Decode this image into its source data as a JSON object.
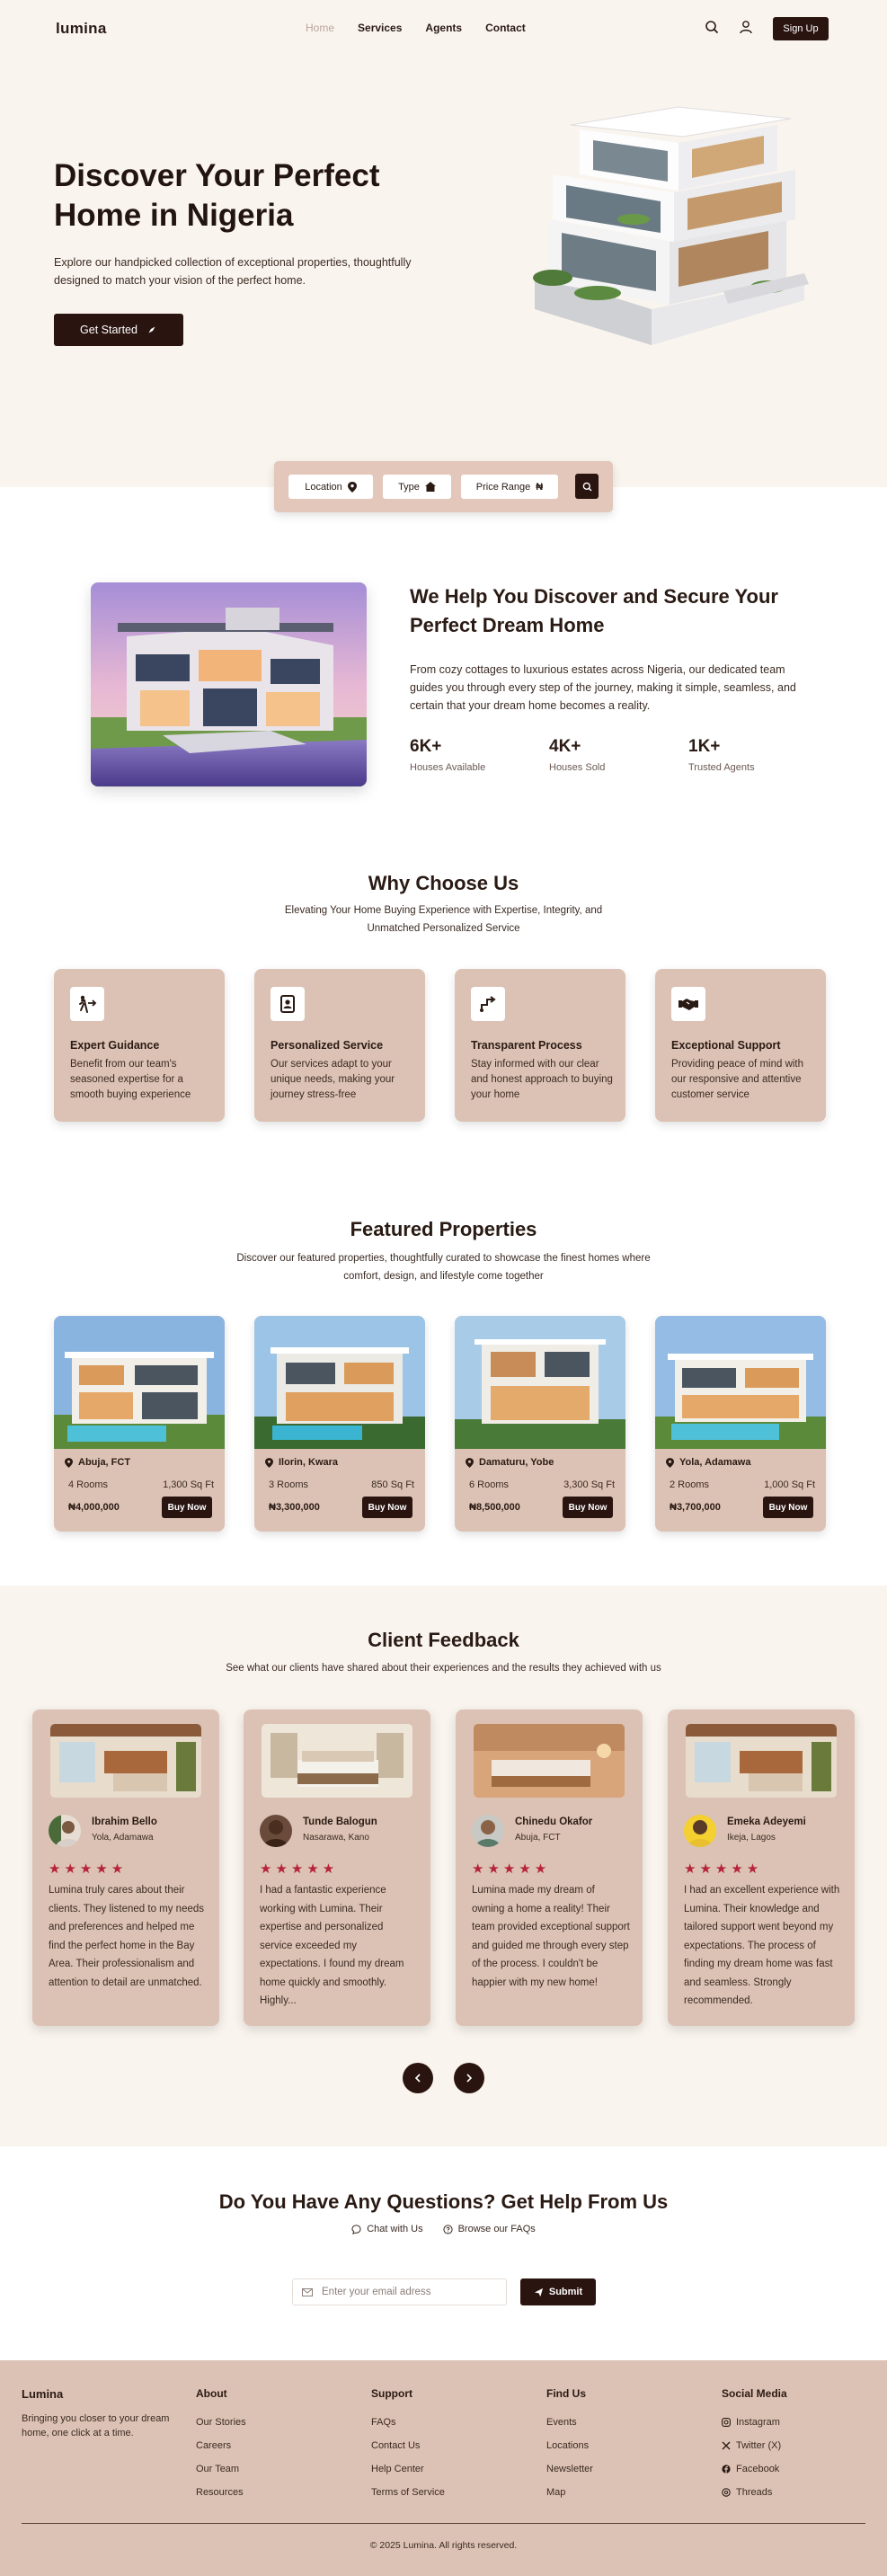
{
  "nav": {
    "logo": "lumina",
    "links": [
      "Home",
      "Services",
      "Agents",
      "Contact"
    ],
    "signup": "Sign Up"
  },
  "hero": {
    "title": "Discover Your Perfect Home in Nigeria",
    "subtitle": "Explore our handpicked collection of exceptional properties, thoughtfully designed to match your vision of the perfect home.",
    "cta": "Get Started"
  },
  "search": {
    "location": "Location",
    "type": "Type",
    "price": "Price Range"
  },
  "about": {
    "title": "We Help You Discover and Secure Your Perfect Dream Home",
    "text": "From cozy cottages to luxurious estates across Nigeria, our dedicated team guides you through every step of the journey, making it simple, seamless, and certain that your dream home becomes a reality.",
    "stats": [
      {
        "num": "6K+",
        "label": "Houses Available"
      },
      {
        "num": "4K+",
        "label": "Houses Sold"
      },
      {
        "num": "1K+",
        "label": "Trusted Agents"
      }
    ]
  },
  "why": {
    "title": "Why Choose Us",
    "subtitle_1": "Elevating Your Home Buying Experience with Expertise, Integrity, and",
    "subtitle_2": "Unmatched Personalized Service",
    "cards": [
      {
        "title": "Expert Guidance",
        "text": "Benefit from our team's seasoned expertise for a smooth buying experience",
        "icon": "walking-person-icon"
      },
      {
        "title": "Personalized Service",
        "text": "Our services adapt to your unique needs, making your journey stress-free",
        "icon": "id-badge-icon"
      },
      {
        "title": "Transparent Process",
        "text": "Stay informed with our clear and honest approach to buying your home",
        "icon": "path-arrow-icon"
      },
      {
        "title": "Exceptional Support",
        "text": "Providing peace of mind with our responsive and attentive customer service",
        "icon": "handshake-icon"
      }
    ]
  },
  "featured": {
    "title": "Featured Properties",
    "subtitle_1": "Discover our featured properties, thoughtfully curated to showcase the finest homes where",
    "subtitle_2": "comfort, design, and lifestyle come together",
    "buy_label": "Buy Now",
    "items": [
      {
        "location": "Abuja, FCT",
        "rooms": "4 Rooms",
        "size": "1,300 Sq Ft",
        "price": "₦4,000,000"
      },
      {
        "location": "Ilorin, Kwara",
        "rooms": "3 Rooms",
        "size": "850 Sq Ft",
        "price": "₦3,300,000"
      },
      {
        "location": "Damaturu, Yobe",
        "rooms": "6 Rooms",
        "size": "3,300 Sq Ft",
        "price": "₦8,500,000"
      },
      {
        "location": "Yola, Adamawa",
        "rooms": "2 Rooms",
        "size": "1,000 Sq Ft",
        "price": "₦3,700,000"
      }
    ]
  },
  "feedback": {
    "title": "Client Feedback",
    "subtitle": "See what our clients have shared about their experiences and the results they achieved with us",
    "stars": "★★★★★",
    "items": [
      {
        "name": "Ibrahim Bello",
        "place": "Yola, Adamawa",
        "text": "Lumina truly cares about their clients. They listened to my needs and preferences and helped me find the perfect home in the Bay Area. Their professionalism and attention to detail are unmatched."
      },
      {
        "name": "Tunde Balogun",
        "place": "Nasarawa, Kano",
        "text": "I had a fantastic experience working with Lumina. Their expertise and personalized service exceeded my expectations. I found my dream home quickly and smoothly. Highly..."
      },
      {
        "name": "Chinedu Okafor",
        "place": "Abuja, FCT",
        "text": "Lumina made my dream of owning a home a reality! Their team provided exceptional support and guided me through every step of the process. I couldn't be happier with my new home!"
      },
      {
        "name": "Emeka Adeyemi",
        "place": "Ikeja, Lagos",
        "text": "I had an excellent experience with Lumina. Their knowledge and tailored support went beyond my expectations. The process of finding my dream home was fast and seamless. Strongly recommended."
      }
    ]
  },
  "help": {
    "title": "Do You Have Any Questions? Get Help From Us",
    "chat": "Chat with Us",
    "faq": "Browse our FAQs",
    "email_placeholder": "Enter your email adress",
    "submit": "Submit"
  },
  "footer": {
    "brand": "Lumina",
    "tagline": "Bringing you closer to your dream home, one click at a time.",
    "columns": [
      {
        "title": "About",
        "items": [
          "Our Stories",
          "Careers",
          "Our Team",
          "Resources"
        ]
      },
      {
        "title": "Support",
        "items": [
          "FAQs",
          "Contact Us",
          "Help Center",
          "Terms of Service"
        ]
      },
      {
        "title": "Find Us",
        "items": [
          "Events",
          "Locations",
          "Newsletter",
          "Map"
        ]
      },
      {
        "title": "Social Media",
        "items": [
          "Instagram",
          "Twitter (X)",
          "Facebook",
          "Threads"
        ]
      }
    ],
    "copyright": "© 2025 Lumina. All rights reserved."
  },
  "colors": {
    "dark": "#2a1410",
    "cream": "#faf4ee",
    "card": "#dcc2b4",
    "star": "#b5243a"
  }
}
